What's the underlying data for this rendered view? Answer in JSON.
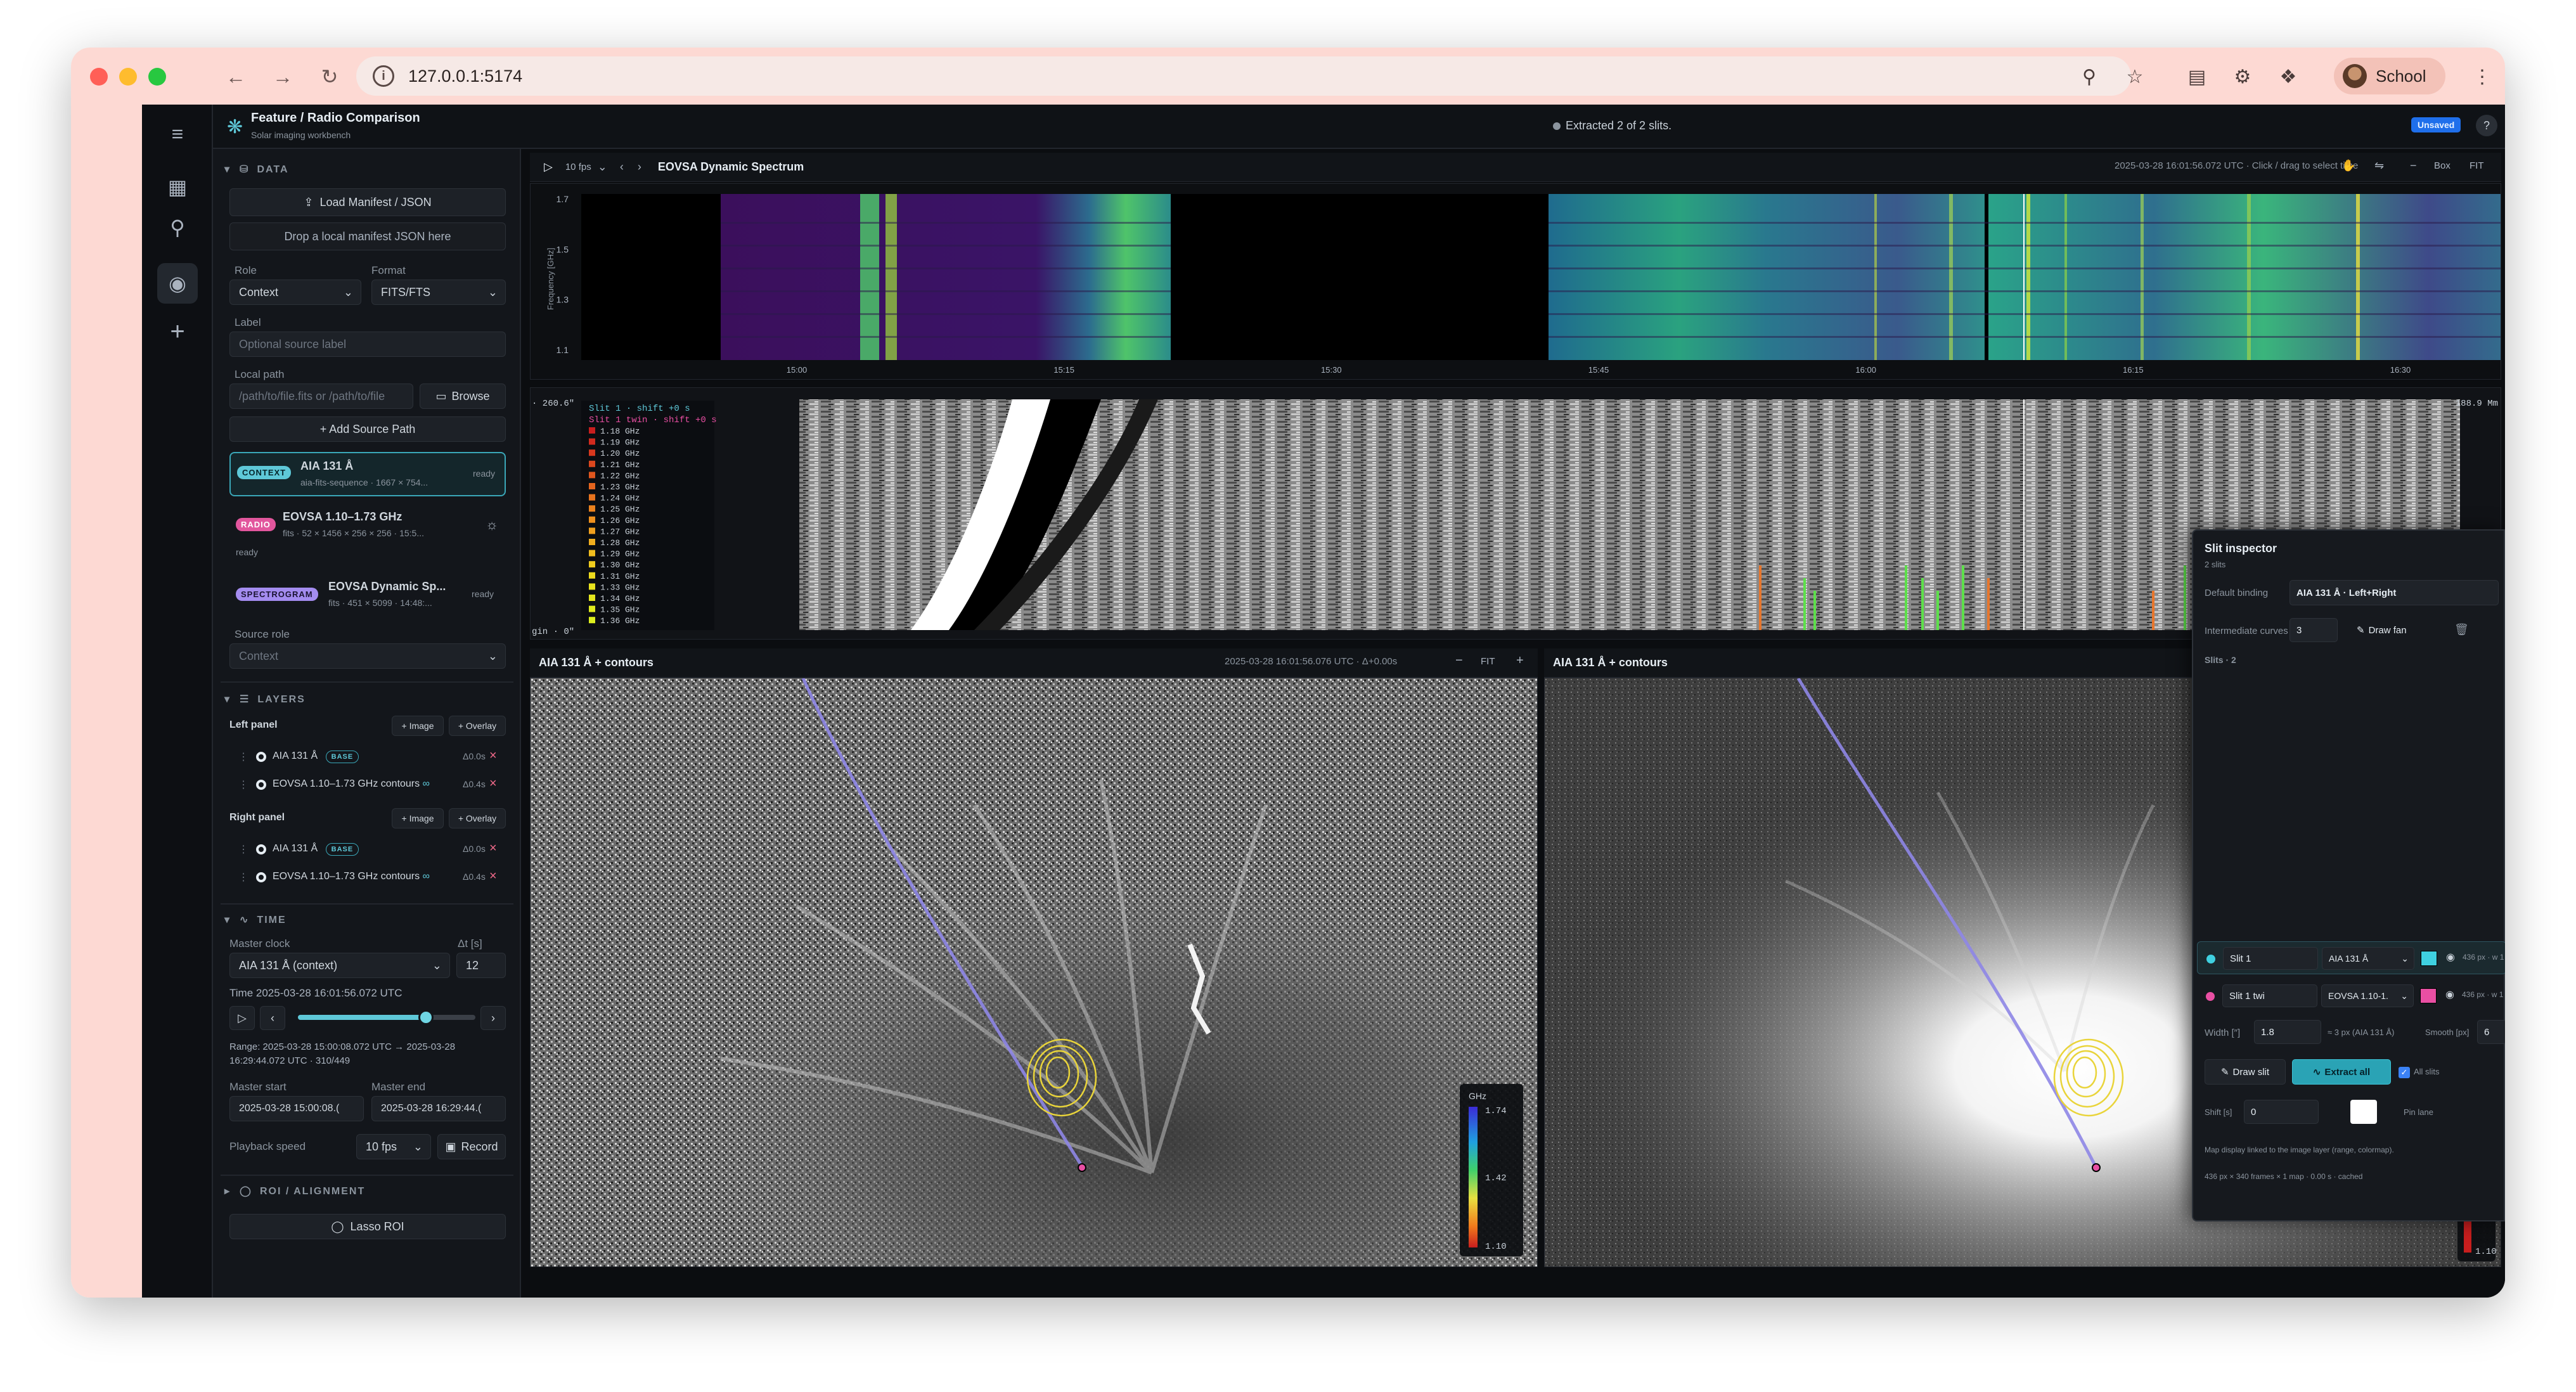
{
  "browser": {
    "url": "127.0.0.1:5174",
    "profile_name": "School",
    "colors": {
      "close": "#ff5f57",
      "minimize": "#febc2e",
      "maximize": "#28c840",
      "frame": "#fdd9d3"
    }
  },
  "app": {
    "title": "Feature / Radio Comparison",
    "subtitle": "Solar imaging workbench",
    "status": "Extracted 2 of 2 slits.",
    "unsaved_badge": "Unsaved",
    "help_label": "?"
  },
  "sidebar": {
    "data": {
      "header": "DATA",
      "load_button": "Load Manifest / JSON",
      "drop_hint": "Drop a local manifest JSON here",
      "role_label": "Role",
      "role_value": "Context",
      "format_label": "Format",
      "format_value": "FITS/FTS",
      "label_label": "Label",
      "label_placeholder": "Optional source label",
      "path_label": "Local path",
      "path_placeholder": "/path/to/file.fits or /path/to/file",
      "browse_button": "Browse",
      "add_source_button": "+ Add Source Path",
      "sources": [
        {
          "badge": "CONTEXT",
          "name": "AIA 131 Å",
          "meta": "aia-fits-sequence · 1667 × 754...",
          "status": "ready",
          "badge_color": "#5ec8d8"
        },
        {
          "badge": "RADIO",
          "name": "EOVSA 1.10–1.73 GHz",
          "meta": "fits · 52 × 1456 × 256 × 256 · 15:5...",
          "status": "ready",
          "badge_color": "#e2569d"
        },
        {
          "badge": "SPECTROGRAM",
          "name": "EOVSA Dynamic Sp...",
          "meta": "fits · 451 × 5099 · 14:48:...",
          "status": "ready",
          "badge_color": "#a48cf0"
        }
      ],
      "source_role_label": "Source role",
      "source_role_value": "Context"
    },
    "layers": {
      "header": "LAYERS",
      "image_button": "+ Image",
      "overlay_button": "+ Overlay",
      "panels": [
        {
          "title": "Left panel",
          "rows": [
            {
              "name": "AIA 131 Å",
              "base": "BASE",
              "delta": "Δ0.0s"
            },
            {
              "name": "EOVSA 1.10–1.73 GHz contours",
              "base": "",
              "delta": "Δ0.4s"
            }
          ]
        },
        {
          "title": "Right panel",
          "rows": [
            {
              "name": "AIA 131 Å",
              "base": "BASE",
              "delta": "Δ0.0s"
            },
            {
              "name": "EOVSA 1.10–1.73 GHz contours",
              "base": "",
              "delta": "Δ0.4s"
            }
          ]
        }
      ]
    },
    "time": {
      "header": "TIME",
      "master_clock_label": "Master clock",
      "master_clock_value": "AIA 131 Å (context)",
      "dt_label": "Δt [s]",
      "dt_value": "12",
      "time_line": "Time 2025-03-28 16:01:56.072 UTC",
      "slider_fraction": 0.72,
      "range_line1": "Range: 2025-03-28 15:00:08.072 UTC → 2025-03-28",
      "range_line2": "16:29:44.072 UTC · 310/449",
      "master_start_label": "Master start",
      "master_start_value": "2025-03-28 15:00:08.(",
      "master_end_label": "Master end",
      "master_end_value": "2025-03-28 16:29:44.(",
      "playback_label": "Playback speed",
      "playback_value": "10 fps",
      "record_button": "Record"
    },
    "roi": {
      "header": "ROI / ALIGNMENT",
      "lasso_button": "Lasso ROI"
    }
  },
  "spectrum": {
    "fps": "10 fps",
    "title": "EOVSA Dynamic Spectrum",
    "info": "2025-03-28 16:01:56.072 UTC · Click / drag to select time",
    "box_button": "Box",
    "fit_button": "FIT",
    "axis_label": "Frequency [GHz]",
    "yticks": [
      "1.7",
      "1.5",
      "1.3",
      "1.1"
    ],
    "xticks": [
      "15:00",
      "15:15",
      "15:30",
      "15:45",
      "16:00",
      "16:15",
      "16:30"
    ]
  },
  "stackplot": {
    "top_left": "· 260.6″",
    "bottom_left": "gin · 0″",
    "top_right": "188.9 Mm",
    "legend_title_1": "Slit 1 · shift +0 s",
    "legend_title_2": "Slit 1 twin · shift +0 s",
    "legend_items": [
      "1.18 GHz",
      "1.19 GHz",
      "1.20 GHz",
      "1.21 GHz",
      "1.22 GHz",
      "1.23 GHz",
      "1.24 GHz",
      "1.25 GHz",
      "1.26 GHz",
      "1.27 GHz",
      "1.28 GHz",
      "1.29 GHz",
      "1.30 GHz",
      "1.31 GHz",
      "1.33 GHz",
      "1.34 GHz",
      "1.35 GHz",
      "1.36 GHz"
    ]
  },
  "left_panel": {
    "title": "AIA 131 Å + contours",
    "info": "2025-03-28 16:01:56.076 UTC · Δ+0.00s",
    "fit_button": "FIT",
    "colorbar": {
      "unit": "GHz",
      "top": "1.74",
      "mid": "1.42",
      "bottom": "1.10"
    }
  },
  "right_panel": {
    "title": "AIA 131 Å + contours",
    "colorbar_bottom": "1.10"
  },
  "inspector": {
    "title": "Slit inspector",
    "count": "2 slits",
    "default_binding_label": "Default binding",
    "default_binding_value": "AIA 131 Å · Left+Right",
    "intermediate_label": "Intermediate curves",
    "intermediate_value": "3",
    "draw_fan_button": "Draw fan",
    "slits_header": "Slits · 2",
    "slits": [
      {
        "name": "Slit 1",
        "layer": "AIA 131 Å",
        "color": "#3fd0e0",
        "meta": "436 px · w 1"
      },
      {
        "name": "Slit 1 twi",
        "layer": "EOVSA 1.10-1.",
        "color": "#e94fa3",
        "meta": "436 px · w 1"
      }
    ],
    "width_label": "Width [″]",
    "width_value": "1.8",
    "width_note": "≈ 3 px (AIA 131 Å)",
    "smooth_label": "Smooth [px]",
    "smooth_value": "6",
    "draw_slit_button": "Draw slit",
    "extract_all_button": "Extract all",
    "all_slits_label": "All slits",
    "shift_label": "Shift [s]",
    "shift_value": "0",
    "pin_lane_label": "Pin lane",
    "note": "Map display linked to the image layer (range, colormap).",
    "footer": "436 px × 340 frames × 1 map · 0.00 s · cached"
  }
}
